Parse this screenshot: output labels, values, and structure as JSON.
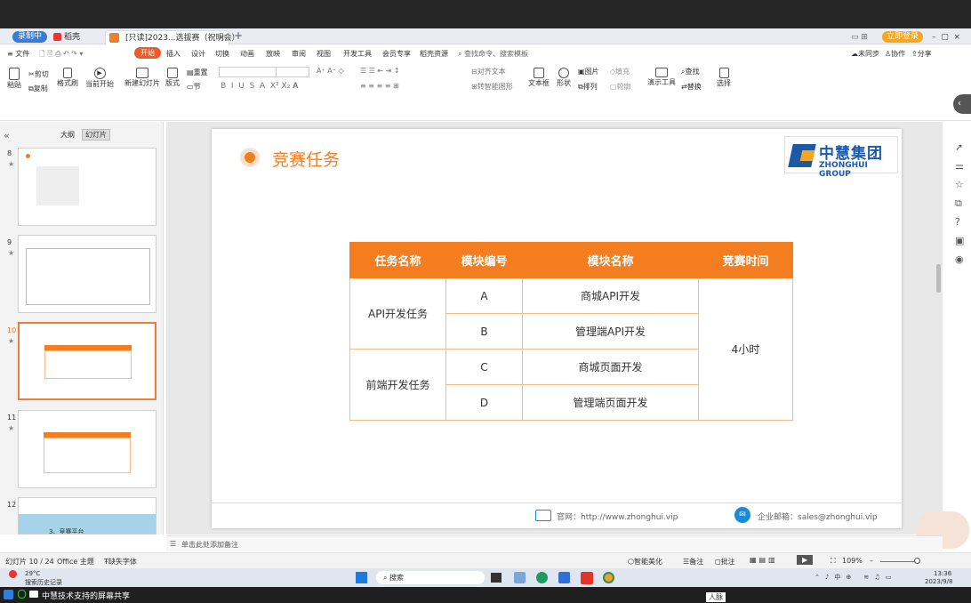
{
  "tabs": {
    "recording": "录制中",
    "home_tab": "稻壳",
    "doc_tab": "[只读]2023...选拔赛（祝明会）",
    "login": "立即登录"
  },
  "menu": [
    "文件",
    "开始",
    "插入",
    "设计",
    "切换",
    "动画",
    "放映",
    "审阅",
    "视图",
    "开发工具",
    "会员专享",
    "稻壳资源"
  ],
  "menu_search": "查找命令、搜索模板",
  "menu_right": [
    "未同步",
    "协作",
    "分享"
  ],
  "ribbon": {
    "paste": "粘贴",
    "cut": "剪切",
    "copy": "复制",
    "format_painter": "格式刷",
    "play_current": "当前开始",
    "new_slide": "新建幻灯片",
    "layout": "版式",
    "section": "节",
    "reset": "重置",
    "align_text": "对齐文本",
    "smart_graphic": "转智能图形",
    "textbox": "文本框",
    "shape": "形状",
    "image": "图片",
    "arrange": "排列",
    "fill": "填充",
    "outline": "轮廓",
    "present_tools": "演示工具",
    "find": "查找",
    "replace": "替换",
    "select": "选择"
  },
  "panel": {
    "outline": "大纲",
    "slides": "幻灯片"
  },
  "thumb_numbers": [
    "8",
    "9",
    "10",
    "11",
    "12"
  ],
  "thumb12_text": "3、竞赛平台",
  "slide": {
    "title": "竞赛任务",
    "logo_cn": "中慧集团",
    "logo_en": "ZHONGHUI GROUP",
    "table": {
      "headers": [
        "任务名称",
        "模块编号",
        "模块名称",
        "竞赛时间"
      ],
      "groups": [
        "API开发任务",
        "前端开发任务"
      ],
      "codes": [
        "A",
        "B",
        "C",
        "D"
      ],
      "modules": [
        "商城API开发",
        "管理端API开发",
        "商城页面开发",
        "管理端页面开发"
      ],
      "time": "4小时"
    },
    "footer_site": "官网：http://www.zhonghui.vip",
    "footer_email": "企业邮箱：sales@zhonghui.vip"
  },
  "notes": "单击此处添加备注",
  "status": {
    "slide_pos": "幻灯片 10 / 24",
    "theme": "Office 主题",
    "missing_font": "缺失字体",
    "smart_beautify": "智能美化",
    "remarks": "备注",
    "comments": "批注",
    "zoom": "109%"
  },
  "taskbar": {
    "weather": "29°C",
    "weather_sub": "搜索历史记录",
    "search": "搜索",
    "time": "13:36",
    "date": "2023/9/8"
  },
  "share_text": "中慧技术支持的屏幕共享",
  "corner_label": "人脉"
}
